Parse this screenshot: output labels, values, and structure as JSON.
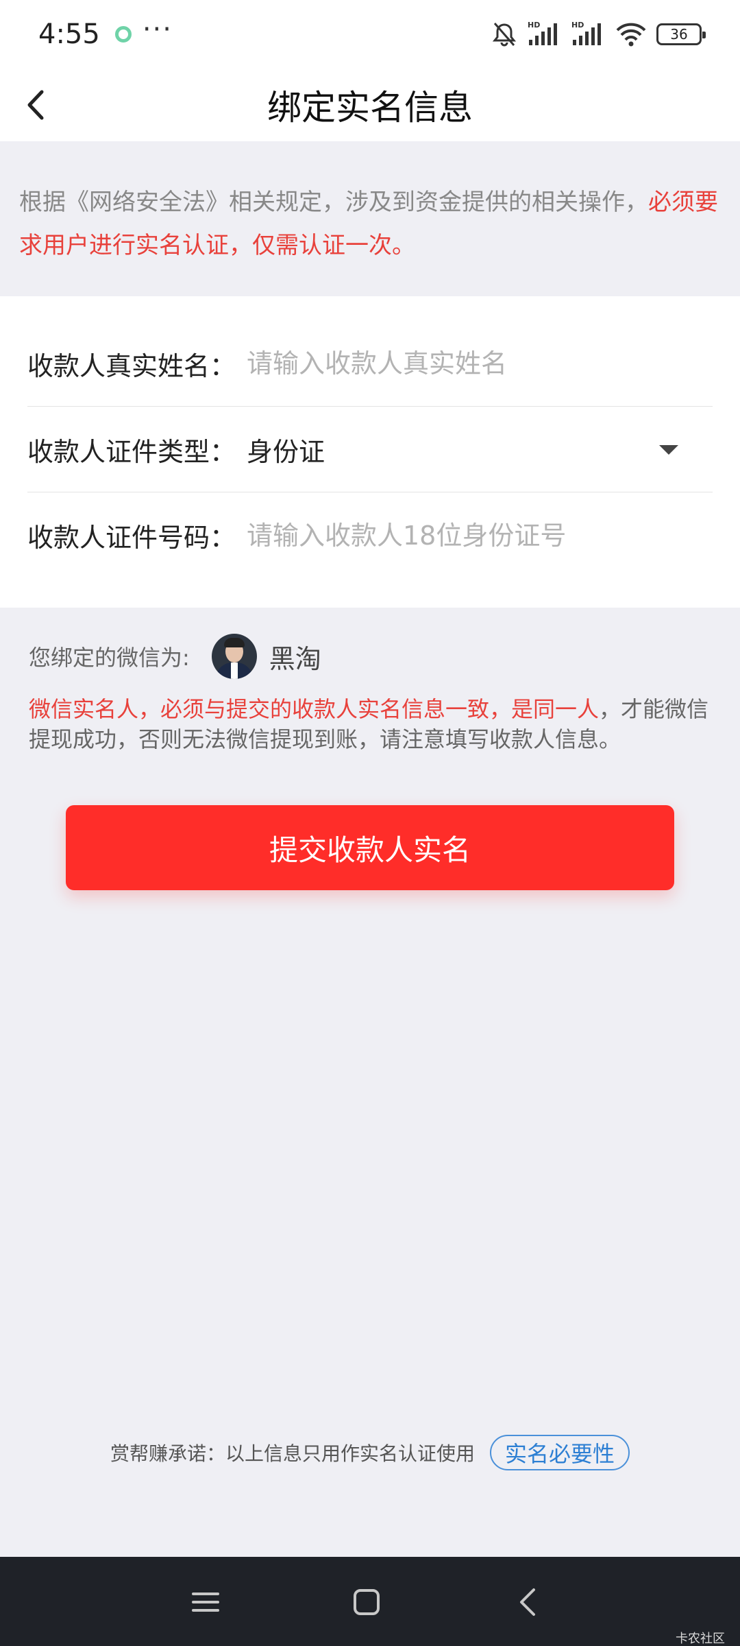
{
  "status_bar": {
    "time": "4:55",
    "more": "···",
    "battery": "36"
  },
  "header": {
    "title": "绑定实名信息"
  },
  "notice": {
    "text_gray": "根据《网络安全法》相关规定，涉及到资金提供的相关操作，",
    "text_red": "必须要求用户进行实名认证，仅需认证一次。"
  },
  "form": {
    "name_label": "收款人真实姓名：",
    "name_placeholder": "请输入收款人真实姓名",
    "id_type_label": "收款人证件类型：",
    "id_type_value": "身份证",
    "id_number_label": "收款人证件号码：",
    "id_number_placeholder": "请输入收款人18位身份证号"
  },
  "wechat": {
    "label": "您绑定的微信为:",
    "name": "黑淘"
  },
  "warning": {
    "part1_red": "微信实名人，必须与提交的收款人实名信息一致，是同一人",
    "part2_gray": "，才能微信提现成功，否则无法微信提现到账，请注意填写收款人信息。"
  },
  "submit_label": "提交收款人实名",
  "promise": {
    "text": "赏帮赚承诺：以上信息只用作实名认证使用",
    "button": "实名必要性"
  },
  "watermark": "卡农社区",
  "colors": {
    "accent_red": "#ff2d29",
    "warning_red": "#e8413b",
    "link_blue": "#2d7fd3",
    "background": "#efeff4"
  }
}
